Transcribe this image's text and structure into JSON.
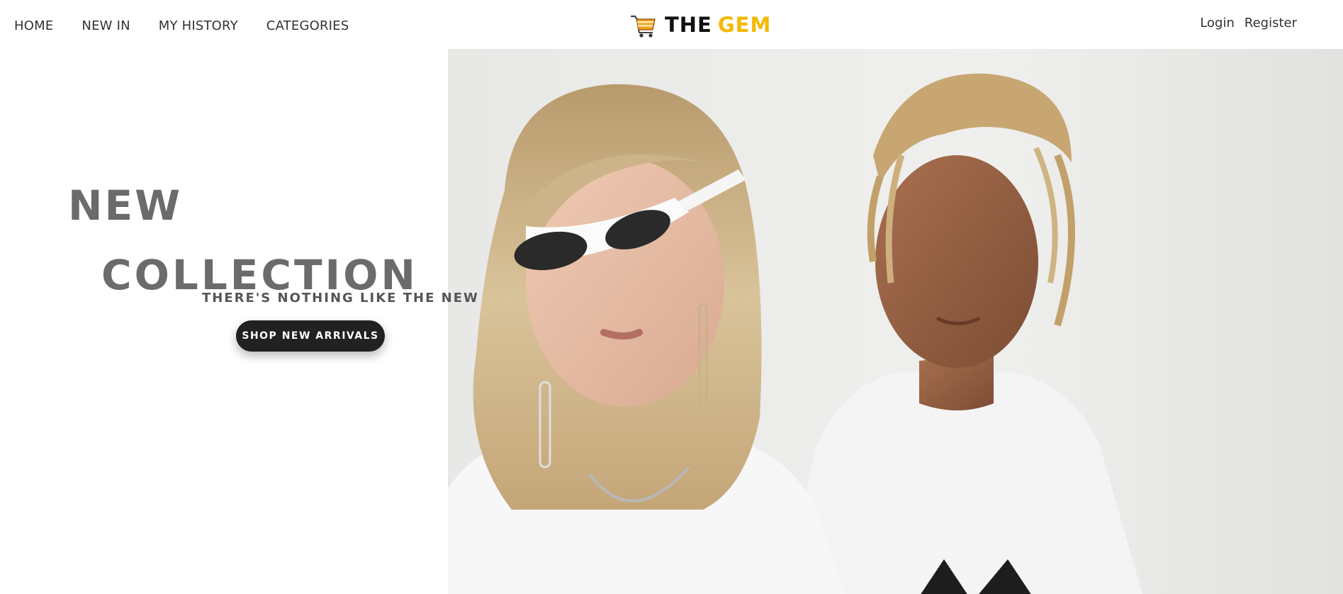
{
  "nav": {
    "left_links": [
      {
        "label": "HOME"
      },
      {
        "label": "NEW IN"
      },
      {
        "label": "MY HISTORY"
      },
      {
        "label": "CATEGORIES"
      }
    ],
    "brand": {
      "icon": "shopping-cart-icon",
      "part1": "THE",
      "part2": "GEM",
      "accent_color": "#f6b800"
    },
    "auth": {
      "login": "Login",
      "register": "Register"
    }
  },
  "hero": {
    "headline_line1": "NEW",
    "headline_line2": "COLLECTION",
    "tagline": "THERE'S NOTHING LIKE THE NEW",
    "cta_label": "SHOP NEW ARRIVALS",
    "cta_color": "#212121",
    "image": "fashion-models-photo"
  }
}
